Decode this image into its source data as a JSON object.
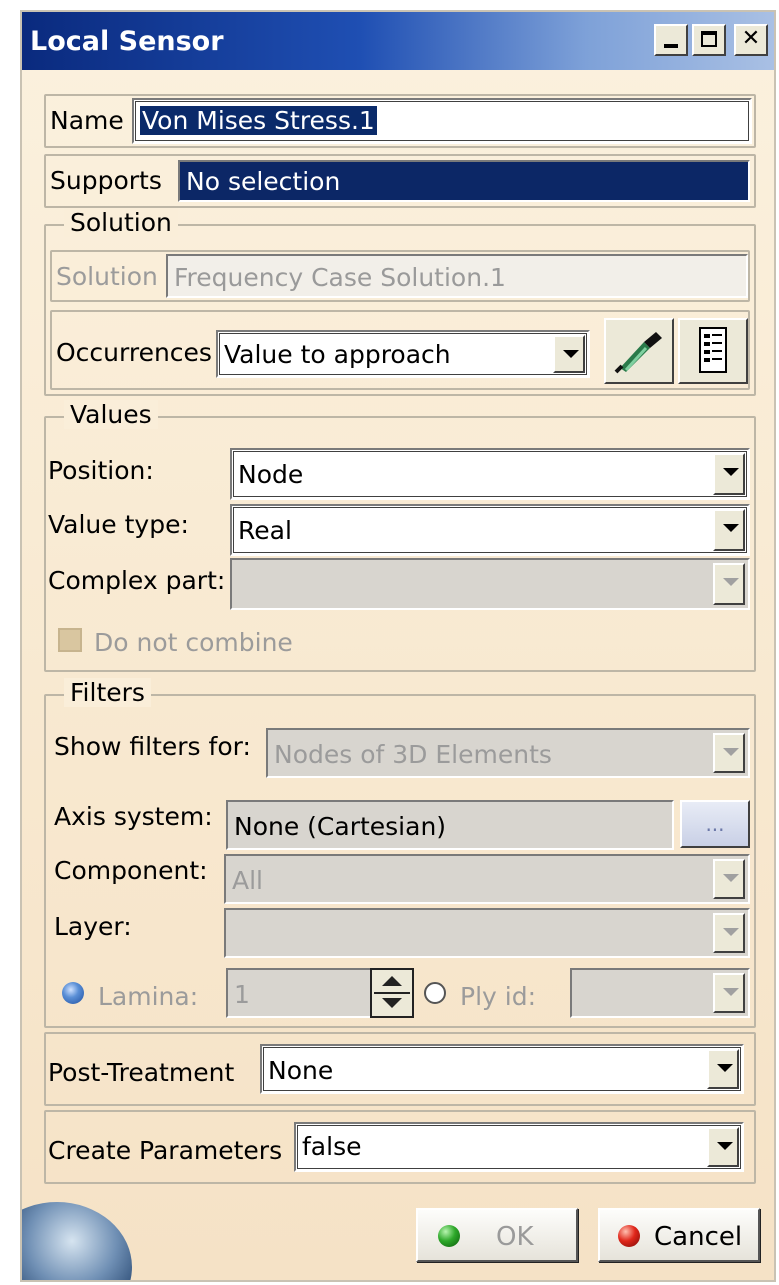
{
  "window": {
    "title": "Local Sensor"
  },
  "name": {
    "label": "Name",
    "value": "Von Mises Stress.1"
  },
  "supports": {
    "label": "Supports",
    "value": "No selection"
  },
  "solution": {
    "legend": "Solution",
    "label": "Solution",
    "value": "Frequency Case Solution.1",
    "occurrences_label": "Occurrences",
    "occurrences_value": "Value to approach"
  },
  "values": {
    "legend": "Values",
    "position_label": "Position:",
    "position_value": "Node",
    "value_type_label": "Value type:",
    "value_type_value": "Real",
    "complex_part_label": "Complex part:",
    "complex_part_value": "",
    "do_not_combine_label": "Do not combine"
  },
  "filters": {
    "legend": "Filters",
    "show_filters_label": "Show filters for:",
    "show_filters_value": "Nodes of 3D Elements",
    "axis_label": "Axis system:",
    "axis_value": "None (Cartesian)",
    "axis_button": "...",
    "component_label": "Component:",
    "component_value": "All",
    "layer_label": "Layer:",
    "layer_value": "",
    "lamina_label": "Lamina:",
    "lamina_value": "1",
    "ply_label": "Ply id:",
    "ply_value": ""
  },
  "post_treatment": {
    "label": "Post-Treatment",
    "value": "None"
  },
  "create_parameters": {
    "label": "Create Parameters",
    "value": "false"
  },
  "buttons": {
    "ok": "OK",
    "cancel": "Cancel"
  }
}
